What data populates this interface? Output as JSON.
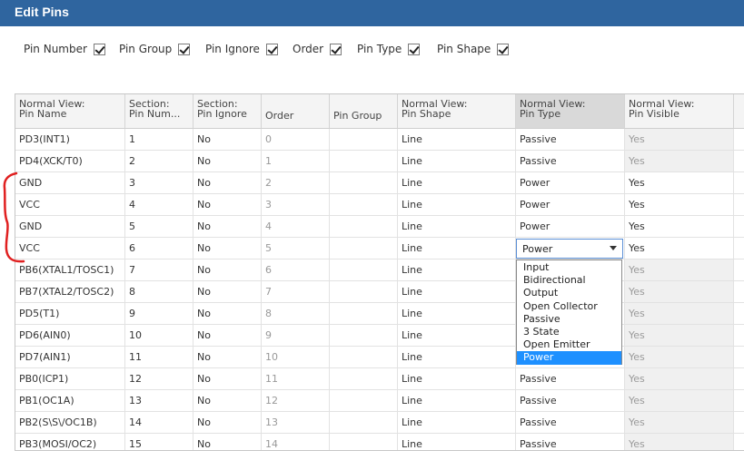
{
  "window": {
    "title": "Edit Pins"
  },
  "options": [
    {
      "label": "Pin Number",
      "checked": true
    },
    {
      "label": "Pin Group",
      "checked": true
    },
    {
      "label": "Pin Ignore",
      "checked": true
    },
    {
      "label": "Order",
      "checked": true
    },
    {
      "label": "Pin Type",
      "checked": true
    },
    {
      "label": "Pin Shape",
      "checked": true
    }
  ],
  "columns": [
    {
      "line1": "Normal View:",
      "line2": "Pin Name"
    },
    {
      "line1": "Section:",
      "line2": "Pin Num..."
    },
    {
      "line1": "Section:",
      "line2": "Pin Ignore"
    },
    {
      "line1": "Order",
      "line2": ""
    },
    {
      "line1": "Pin Group",
      "line2": ""
    },
    {
      "line1": "Normal View:",
      "line2": "Pin Shape"
    },
    {
      "line1": "Normal View:",
      "line2": "Pin Type"
    },
    {
      "line1": "Normal View:",
      "line2": "Pin Visible"
    }
  ],
  "rows": [
    {
      "name": "PD3(INT1)",
      "num": "1",
      "ignore": "No",
      "order": "0",
      "group": "",
      "shape": "Line",
      "type": "Passive",
      "visible": "Yes"
    },
    {
      "name": "PD4(XCK/T0)",
      "num": "2",
      "ignore": "No",
      "order": "1",
      "group": "",
      "shape": "Line",
      "type": "Passive",
      "visible": "Yes"
    },
    {
      "name": "GND",
      "num": "3",
      "ignore": "No",
      "order": "2",
      "group": "",
      "shape": "Line",
      "type": "Power",
      "visible": "Yes"
    },
    {
      "name": "VCC",
      "num": "4",
      "ignore": "No",
      "order": "3",
      "group": "",
      "shape": "Line",
      "type": "Power",
      "visible": "Yes"
    },
    {
      "name": "GND",
      "num": "5",
      "ignore": "No",
      "order": "4",
      "group": "",
      "shape": "Line",
      "type": "Power",
      "visible": "Yes"
    },
    {
      "name": "VCC",
      "num": "6",
      "ignore": "No",
      "order": "5",
      "group": "",
      "shape": "Line",
      "type": "",
      "visible": "Yes"
    },
    {
      "name": "PB6(XTAL1/TOSC1)",
      "num": "7",
      "ignore": "No",
      "order": "6",
      "group": "",
      "shape": "Line",
      "type": "",
      "visible": "Yes"
    },
    {
      "name": "PB7(XTAL2/TOSC2)",
      "num": "8",
      "ignore": "No",
      "order": "7",
      "group": "",
      "shape": "Line",
      "type": "",
      "visible": "Yes"
    },
    {
      "name": "PD5(T1)",
      "num": "9",
      "ignore": "No",
      "order": "8",
      "group": "",
      "shape": "Line",
      "type": "",
      "visible": "Yes"
    },
    {
      "name": "PD6(AIN0)",
      "num": "10",
      "ignore": "No",
      "order": "9",
      "group": "",
      "shape": "Line",
      "type": "",
      "visible": "Yes"
    },
    {
      "name": "PD7(AIN1)",
      "num": "11",
      "ignore": "No",
      "order": "10",
      "group": "",
      "shape": "Line",
      "type": "",
      "visible": "Yes"
    },
    {
      "name": "PB0(ICP1)",
      "num": "12",
      "ignore": "No",
      "order": "11",
      "group": "",
      "shape": "Line",
      "type": "Passive",
      "visible": "Yes"
    },
    {
      "name": "PB1(OC1A)",
      "num": "13",
      "ignore": "No",
      "order": "12",
      "group": "",
      "shape": "Line",
      "type": "Passive",
      "visible": "Yes"
    },
    {
      "name": "PB2(S\\S\\/OC1B)",
      "num": "14",
      "ignore": "No",
      "order": "13",
      "group": "",
      "shape": "Line",
      "type": "Passive",
      "visible": "Yes"
    },
    {
      "name": "PB3(MOSI/OC2)",
      "num": "15",
      "ignore": "No",
      "order": "14",
      "group": "",
      "shape": "Line",
      "type": "Passive",
      "visible": "Yes"
    }
  ],
  "editor": {
    "value": "Power",
    "options": [
      "Input",
      "Bidirectional",
      "Output",
      "Open Collector",
      "Passive",
      "3 State",
      "Open Emitter",
      "Power"
    ],
    "selected": "Power"
  },
  "colors": {
    "titlebar": "#2f659f",
    "selection": "#1e90ff",
    "annotation": "#e02020"
  }
}
